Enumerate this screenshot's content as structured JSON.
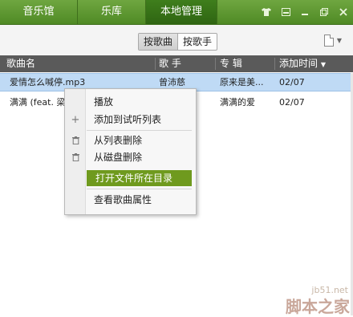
{
  "tabs": [
    {
      "label": "音乐馆"
    },
    {
      "label": "乐库"
    },
    {
      "label": "本地管理"
    }
  ],
  "window_controls": [
    "shirt-icon",
    "mini-mode-icon",
    "minimize-icon",
    "maximize-icon",
    "close-icon"
  ],
  "toolbar": {
    "by_song": "按歌曲",
    "by_artist": "按歌手"
  },
  "columns": {
    "name": "歌曲名",
    "artist": "歌 手",
    "album": "专 辑",
    "added": "添加时间"
  },
  "rows": [
    {
      "name": "爱情怎么喊停.mp3",
      "artist": "曾沛慈",
      "album": "原来是美...",
      "added": "02/07"
    },
    {
      "name": "满满 (feat. 梁",
      "artist": "",
      "album": "满满的爱",
      "added": "02/07"
    }
  ],
  "context_menu": {
    "play": "播放",
    "add_to_trial": "添加到试听列表",
    "remove_from_list": "从列表删除",
    "delete_from_disk": "从磁盘删除",
    "open_folder": "打开文件所在目录",
    "properties": "查看歌曲属性"
  },
  "colors": {
    "accent_green": "#4f8a25",
    "menu_highlight": "#6f9a1e",
    "selected_row": "#bfdaf5",
    "header_gray": "#5a5a5a"
  },
  "watermark": {
    "site": "jb51.net",
    "name": "脚本之家"
  }
}
